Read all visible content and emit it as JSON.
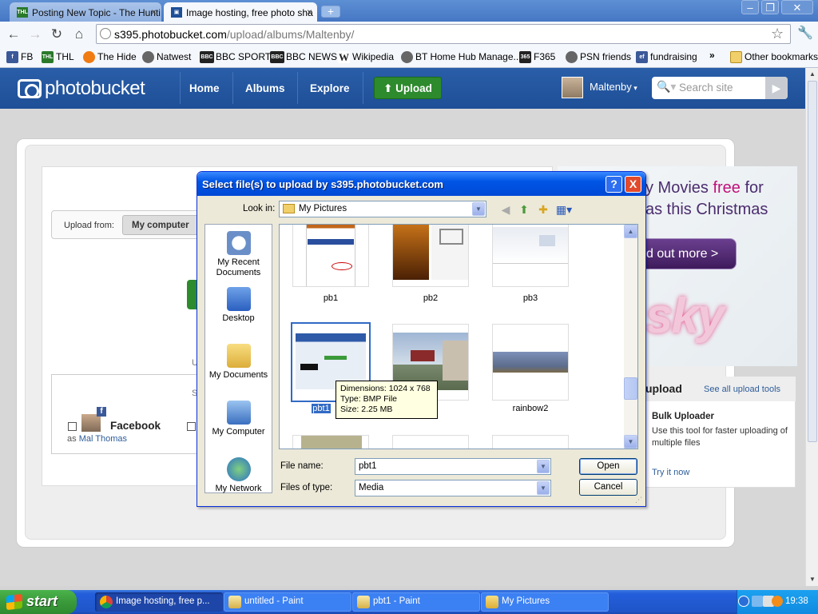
{
  "browser": {
    "tabs": [
      {
        "label": "Posting New Topic - The Hunti",
        "favicon": "THL",
        "active": false
      },
      {
        "label": "Image hosting, free photo sha",
        "favicon": "photobucket",
        "active": true
      }
    ],
    "window_controls": [
      "minimize-icon",
      "restore-icon",
      "close-icon"
    ],
    "url_host": "s395.photobucket.com",
    "url_path": "/upload/albums/Maltenby/",
    "bookmarks": [
      {
        "label": "FB",
        "icon": "FB",
        "color": "#3b5998"
      },
      {
        "label": "THL",
        "icon": "THL",
        "color": "#2a7a2a"
      },
      {
        "label": "The Hide",
        "icon": "",
        "color": "#f07b12"
      },
      {
        "label": "Natwest",
        "icon": "",
        "color": "#666666"
      },
      {
        "label": "BBC SPORT",
        "icon": "BBC",
        "color": "#222222"
      },
      {
        "label": "BBC NEWS",
        "icon": "BBC",
        "color": "#222222"
      },
      {
        "label": "Wikipedia",
        "icon": "W",
        "color": "#333333"
      },
      {
        "label": "BT Home Hub Manage...",
        "icon": "",
        "color": "#666666"
      },
      {
        "label": "F365",
        "icon": "365",
        "color": "#222222"
      },
      {
        "label": "PSN friends",
        "icon": "",
        "color": "#666666"
      },
      {
        "label": "fundraising",
        "icon": "ef",
        "color": "#3b5998"
      }
    ],
    "overflow": "»",
    "other_bookmarks": "Other bookmarks"
  },
  "photobucket": {
    "logo": "photobucket",
    "nav": [
      "Home",
      "Albums",
      "Explore"
    ],
    "upload_button": "Upload",
    "username": "Maltenby",
    "search_placeholder": "Search site",
    "upload_from_label": "Upload from:",
    "upload_from_value": "My computer",
    "stub_u": "U",
    "stub_s": "S",
    "facebook_label": "Facebook",
    "facebook_as": "as",
    "facebook_user": "Mal Thomas",
    "ad": {
      "line1_a": "y Movies ",
      "line1_b": "free",
      "line1_c": " for",
      "line2": "as this Christmas",
      "button": "d out more >",
      "brand": "sky"
    },
    "tools": {
      "title": "upload",
      "link": "See all upload tools",
      "bulk_title": "Bulk Uploader",
      "bulk_desc": "Use this tool for faster uploading of multiple files",
      "try_it": "Try it now"
    }
  },
  "dialog": {
    "title": "Select file(s) to upload by s395.photobucket.com",
    "help": "?",
    "close": "X",
    "look_in_label": "Look in:",
    "look_in_value": "My Pictures",
    "places": [
      "My Recent Documents",
      "Desktop",
      "My Documents",
      "My Computer",
      "My Network"
    ],
    "files": [
      {
        "name": "pb1",
        "selected": false
      },
      {
        "name": "pb2",
        "selected": false
      },
      {
        "name": "pb3",
        "selected": false
      },
      {
        "name": "pbt1",
        "selected": true
      },
      {
        "name": "",
        "selected": false
      },
      {
        "name": "rainbow2",
        "selected": false
      }
    ],
    "tooltip": {
      "dimensions": "Dimensions: 1024 x 768",
      "type": "Type: BMP File",
      "size": "Size: 2.25 MB"
    },
    "file_name_label": "File name:",
    "file_name_value": "pbt1",
    "file_type_label": "Files of type:",
    "file_type_value": "Media",
    "open_button": "Open",
    "cancel_button": "Cancel"
  },
  "taskbar": {
    "start": "start",
    "tasks": [
      {
        "label": "Image hosting, free p...",
        "active": true
      },
      {
        "label": "untitled - Paint",
        "active": false
      },
      {
        "label": "pbt1 - Paint",
        "active": false
      },
      {
        "label": "My Pictures",
        "active": false
      }
    ],
    "clock": "19:38"
  }
}
